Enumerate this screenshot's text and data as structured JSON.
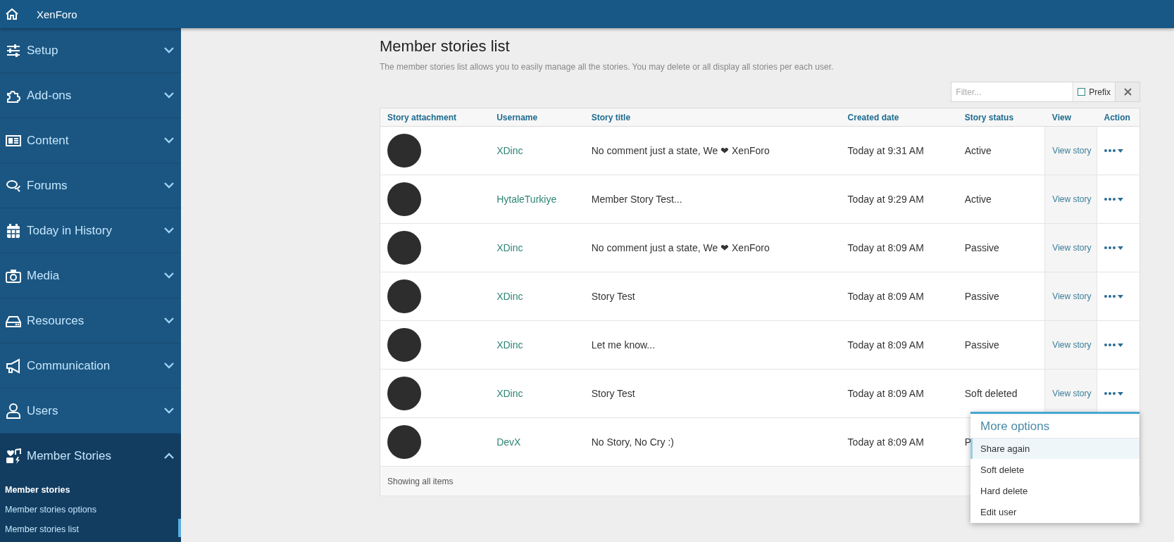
{
  "topbar": {
    "title": "XenForo"
  },
  "sidebar": {
    "items": [
      {
        "label": "Setup",
        "expanded": false
      },
      {
        "label": "Add-ons",
        "expanded": false
      },
      {
        "label": "Content",
        "expanded": false
      },
      {
        "label": "Forums",
        "expanded": false
      },
      {
        "label": "Today in History",
        "expanded": false
      },
      {
        "label": "Media",
        "expanded": false
      },
      {
        "label": "Resources",
        "expanded": false
      },
      {
        "label": "Communication",
        "expanded": false
      },
      {
        "label": "Users",
        "expanded": false
      },
      {
        "label": "Member Stories",
        "expanded": true,
        "children": [
          {
            "label": "Member stories",
            "kind": "heading",
            "selected": false
          },
          {
            "label": "Member stories options",
            "kind": "link",
            "selected": false
          },
          {
            "label": "Member stories list",
            "kind": "link",
            "selected": true
          }
        ]
      }
    ]
  },
  "page": {
    "title": "Member stories list",
    "description": "The member stories list allows you to easily manage all the stories. You may delete or all display all stories per each user.",
    "filter": {
      "placeholder": "Filter...",
      "prefix_label": "Prefix",
      "prefix_checked": false
    },
    "table": {
      "columns": [
        "Story attachment",
        "Username",
        "Story title",
        "Created date",
        "Story status",
        "View",
        "Action"
      ],
      "rows": [
        {
          "username": "XDinc",
          "title": "No comment just a state, We ❤ XenForo",
          "created": "Today at 9:31 AM",
          "status": "Active",
          "view": "View story"
        },
        {
          "username": "HytaleTurkiye",
          "title": "Member Story Test...",
          "created": "Today at 9:29 AM",
          "status": "Active",
          "view": "View story"
        },
        {
          "username": "XDinc",
          "title": "No comment just a state, We ❤ XenForo",
          "created": "Today at 8:09 AM",
          "status": "Passive",
          "view": "View story"
        },
        {
          "username": "XDinc",
          "title": "Story Test",
          "created": "Today at 8:09 AM",
          "status": "Passive",
          "view": "View story"
        },
        {
          "username": "XDinc",
          "title": "Let me know...",
          "created": "Today at 8:09 AM",
          "status": "Passive",
          "view": "View story"
        },
        {
          "username": "XDinc",
          "title": "Story Test",
          "created": "Today at 8:09 AM",
          "status": "Soft deleted",
          "view": "View story"
        },
        {
          "username": "DevX",
          "title": "No Story, No Cry :)",
          "created": "Today at 8:09 AM",
          "status": "P",
          "view": ""
        }
      ],
      "footer": "Showing all items"
    },
    "menu": {
      "title": "More options",
      "items": [
        {
          "label": "Share again",
          "selected": true
        },
        {
          "label": "Soft delete",
          "selected": false
        },
        {
          "label": "Hard delete",
          "selected": false
        },
        {
          "label": "Edit user",
          "selected": false
        }
      ]
    }
  }
}
